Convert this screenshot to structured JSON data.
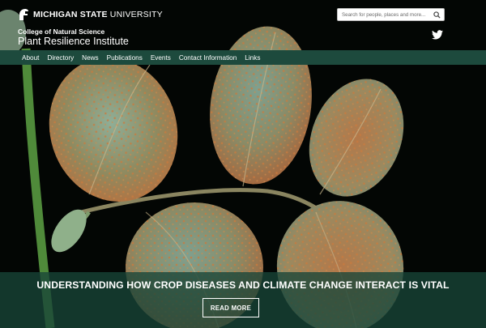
{
  "header": {
    "university_bold": "MICHIGAN STATE",
    "university_light": "UNIVERSITY",
    "college": "College of Natural Science",
    "institute": "Plant Resilience Institute",
    "search_placeholder": "Search for people, places and more...",
    "logo_icon": "spartan-helmet-icon",
    "social_icon": "twitter-icon"
  },
  "nav": {
    "items": [
      "About",
      "Directory",
      "News",
      "Publications",
      "Events",
      "Contact Information",
      "Links"
    ]
  },
  "hero": {
    "headline": "UNDERSTANDING HOW CROP DISEASES AND CLIMATE CHANGE INTERACT IS VITAL",
    "button_label": "READ MORE"
  },
  "colors": {
    "nav_background": "#1d4a3d",
    "banner_overlay": "#184538",
    "leaf_green": "#6f9783",
    "rust_spots": "#c2713b"
  }
}
